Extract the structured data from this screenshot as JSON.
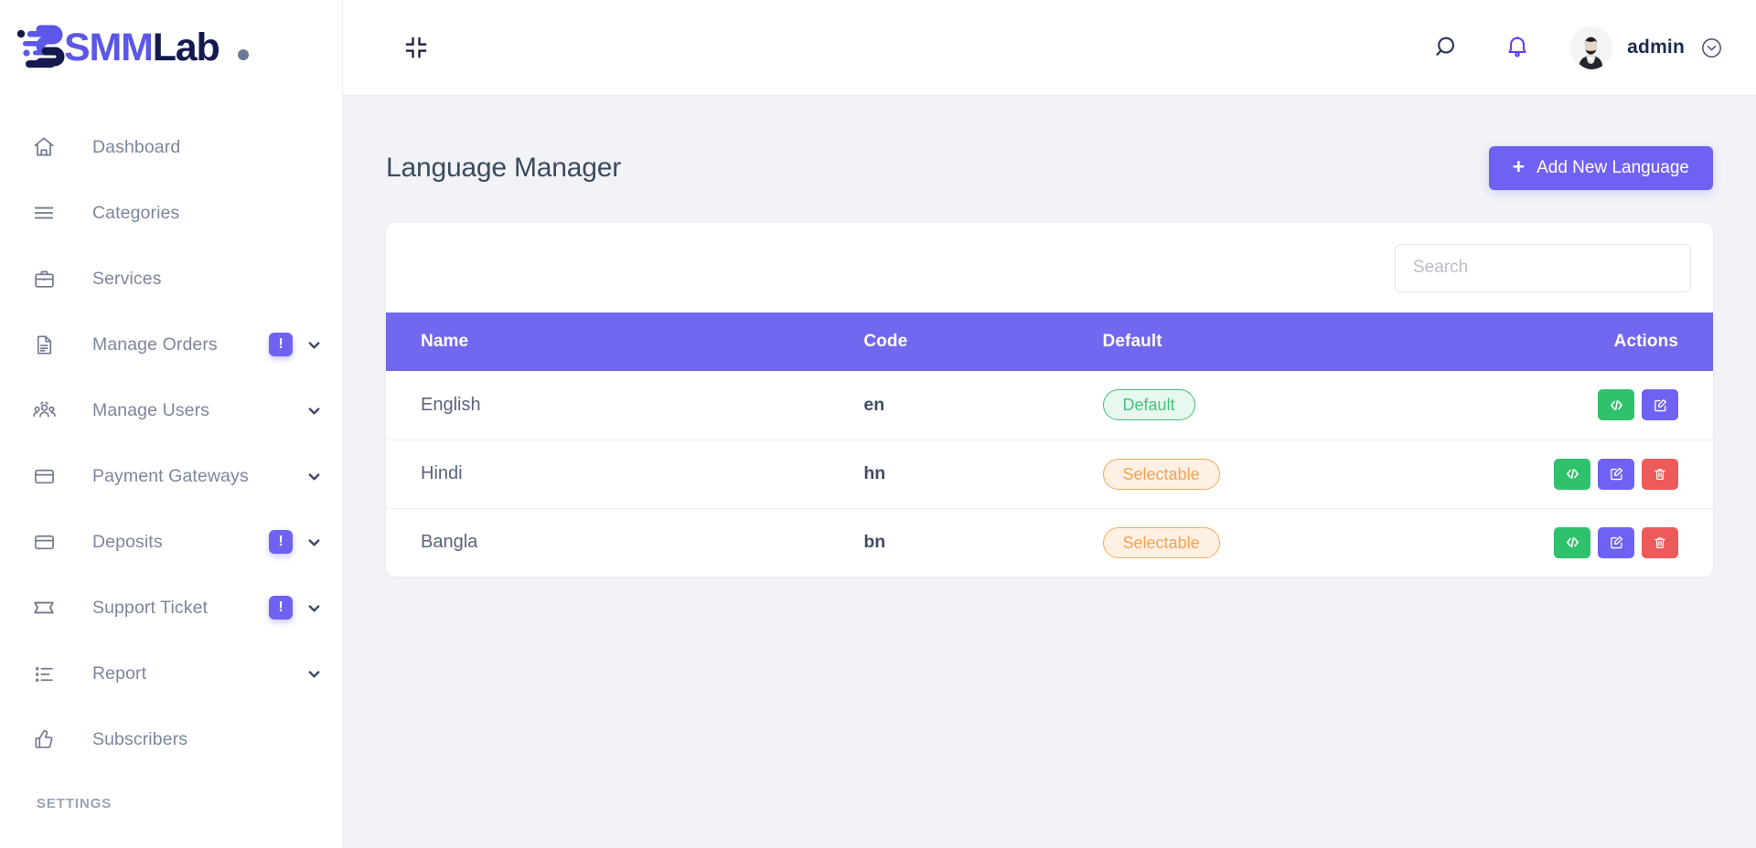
{
  "brand": {
    "name_part1": "SMM",
    "name_part2": "Lab",
    "accent_color": "#5b57e8",
    "dark_color": "#141a4e"
  },
  "sidebar": {
    "items": [
      {
        "label": "Dashboard",
        "icon": "home-icon",
        "badge": null,
        "chevron": false
      },
      {
        "label": "Categories",
        "icon": "list-icon",
        "badge": null,
        "chevron": false
      },
      {
        "label": "Services",
        "icon": "briefcase-icon",
        "badge": null,
        "chevron": false
      },
      {
        "label": "Manage Orders",
        "icon": "document-icon",
        "badge": "!",
        "chevron": true
      },
      {
        "label": "Manage Users",
        "icon": "users-icon",
        "badge": null,
        "chevron": true
      },
      {
        "label": "Payment Gateways",
        "icon": "credit-card-icon",
        "badge": null,
        "chevron": true
      },
      {
        "label": "Deposits",
        "icon": "credit-card-icon",
        "badge": "!",
        "chevron": true
      },
      {
        "label": "Support Ticket",
        "icon": "ticket-icon",
        "badge": "!",
        "chevron": true
      },
      {
        "label": "Report",
        "icon": "report-list-icon",
        "badge": null,
        "chevron": true
      },
      {
        "label": "Subscribers",
        "icon": "thumbs-up-icon",
        "badge": null,
        "chevron": false
      }
    ],
    "section_title": "SETTINGS",
    "badge_color": "#6f62f2"
  },
  "topbar": {
    "collapse_icon": "collapse-icon",
    "search_icon": "search-icon",
    "notification_icon": "bell-icon",
    "username": "admin",
    "user_chevron_icon": "chevron-down-circle-icon"
  },
  "page": {
    "title": "Language Manager",
    "add_button_label": "Add New Language",
    "add_button_icon": "plus-icon",
    "primary_color": "#6f62f2"
  },
  "search": {
    "value": "",
    "placeholder": "Search"
  },
  "table": {
    "columns": [
      "Name",
      "Code",
      "Default",
      "Actions"
    ],
    "rows": [
      {
        "name": "English",
        "code": "en",
        "status": "Default",
        "status_type": "default",
        "actions": [
          "code",
          "edit"
        ]
      },
      {
        "name": "Hindi",
        "code": "hn",
        "status": "Selectable",
        "status_type": "selectable",
        "actions": [
          "code",
          "edit",
          "delete"
        ]
      },
      {
        "name": "Bangla",
        "code": "bn",
        "status": "Selectable",
        "status_type": "selectable",
        "actions": [
          "code",
          "edit",
          "delete"
        ]
      }
    ],
    "header_bg": "#7168ef",
    "action_colors": {
      "code": "#2fc16c",
      "edit": "#6f62f2",
      "delete": "#ec5a5a"
    }
  }
}
